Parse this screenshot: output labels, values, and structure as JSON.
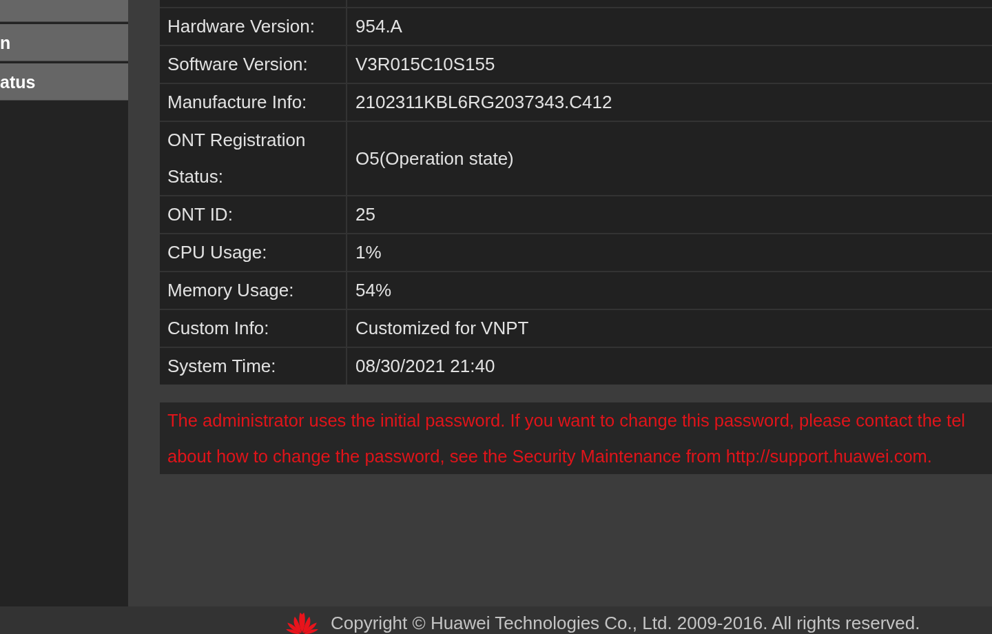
{
  "sidebar": {
    "items": [
      {
        "label": "n"
      },
      {
        "label": "atus"
      }
    ]
  },
  "device_info": {
    "rows": [
      {
        "label": "Hardware Version:",
        "value": "954.A"
      },
      {
        "label": "Software Version:",
        "value": "V3R015C10S155"
      },
      {
        "label": "Manufacture Info:",
        "value": "2102311KBL6RG2037343.C412"
      },
      {
        "label": "ONT Registration Status:",
        "value": "O5(Operation state)"
      },
      {
        "label": "ONT ID:",
        "value": "25"
      },
      {
        "label": "CPU Usage:",
        "value": "1%"
      },
      {
        "label": "Memory Usage:",
        "value": "54%"
      },
      {
        "label": "Custom Info:",
        "value": "Customized for VNPT"
      },
      {
        "label": "System Time:",
        "value": "08/30/2021 21:40"
      }
    ]
  },
  "warning": {
    "lines": [
      "The administrator uses the initial password. If you want to change this password, please contact the tel",
      "about how to change the password, see the Security Maintenance from http://support.huawei.com."
    ]
  },
  "footer": {
    "copyright": "Copyright © Huawei Technologies Co., Ltd. 2009-2016. All rights reserved."
  }
}
